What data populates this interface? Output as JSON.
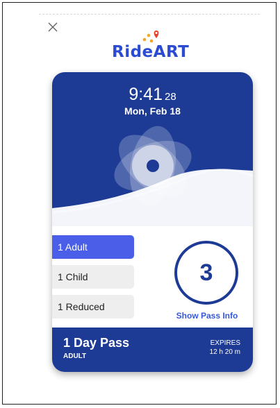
{
  "app": {
    "logo_text": "RideART",
    "close_icon": "close-icon",
    "brand_blue": "#1d3b95",
    "accent_blue": "#4a5ee8",
    "link_blue": "#3459d8"
  },
  "ticket": {
    "time_hm": "9:41",
    "time_sec": "28",
    "date": "Mon, Feb 18",
    "riders": [
      {
        "label": "1 Adult",
        "selected": true
      },
      {
        "label": "1 Child",
        "selected": false
      },
      {
        "label": "1 Reduced",
        "selected": false
      }
    ],
    "count": "3",
    "show_info_label": "Show Pass Info",
    "pass_name": "1 Day Pass",
    "pass_type": "ADULT",
    "expires_label": "EXPIRES",
    "expires_value": "12 h 20 m"
  }
}
